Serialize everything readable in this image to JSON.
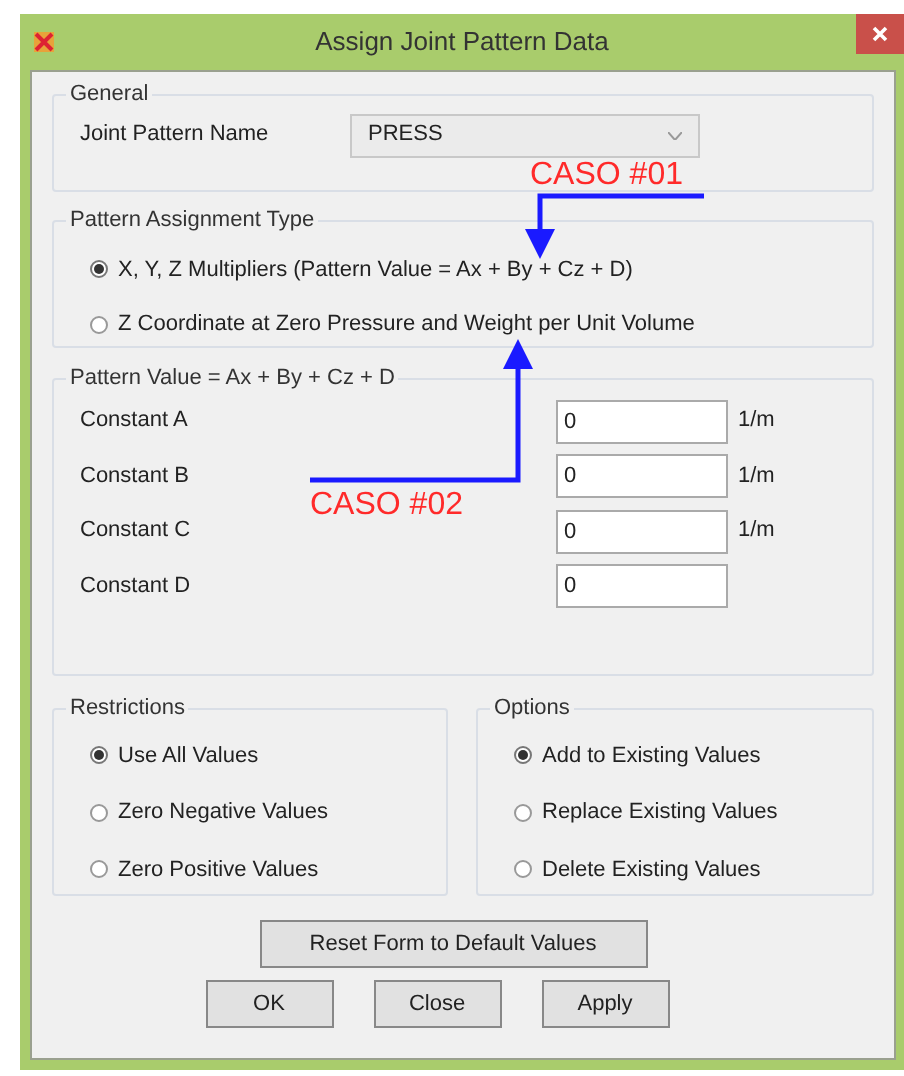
{
  "window": {
    "title": "Assign Joint Pattern Data"
  },
  "general": {
    "legend": "General",
    "joint_pattern_name": {
      "label": "Joint Pattern Name",
      "value": "PRESS"
    }
  },
  "pattern_assignment_type": {
    "legend": "Pattern Assignment Type",
    "options": [
      {
        "label": "X, Y, Z Multipliers  (Pattern Value = Ax + By + Cz + D)",
        "selected": true
      },
      {
        "label": "Z Coordinate at Zero Pressure and Weight per Unit Volume",
        "selected": false
      }
    ]
  },
  "pattern_value": {
    "legend": "Pattern Value = Ax + By + Cz + D",
    "constants": [
      {
        "label": "Constant A",
        "value": "0",
        "unit": "1/m"
      },
      {
        "label": "Constant B",
        "value": "0",
        "unit": "1/m"
      },
      {
        "label": "Constant C",
        "value": "0",
        "unit": "1/m"
      },
      {
        "label": "Constant D",
        "value": "0"
      }
    ]
  },
  "restrictions": {
    "legend": "Restrictions",
    "options": [
      {
        "label": "Use All Values",
        "selected": true
      },
      {
        "label": "Zero Negative Values",
        "selected": false
      },
      {
        "label": "Zero Positive Values",
        "selected": false
      }
    ]
  },
  "options": {
    "legend": "Options",
    "options": [
      {
        "label": "Add to Existing Values",
        "selected": true
      },
      {
        "label": "Replace Existing Values",
        "selected": false
      },
      {
        "label": "Delete Existing Values",
        "selected": false
      }
    ]
  },
  "reset_button": "Reset Form to Default Values",
  "buttons": [
    "OK",
    "Close",
    "Apply"
  ],
  "annotations": [
    {
      "text": "CASO #01"
    },
    {
      "text": "CASO #02"
    }
  ]
}
